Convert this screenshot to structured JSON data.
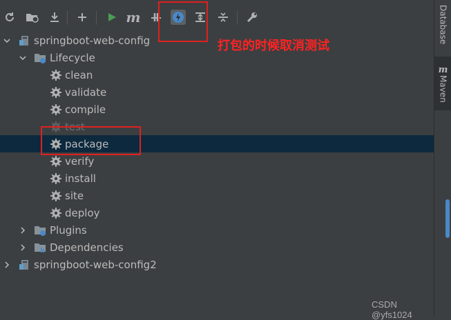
{
  "toolbar": {
    "buttons": [
      {
        "name": "reload-icon"
      },
      {
        "name": "add-folder-icon"
      },
      {
        "name": "download-icon"
      },
      {
        "name": "plus-icon"
      },
      {
        "name": "run-icon"
      },
      {
        "name": "maven-goal-icon",
        "text": "m"
      },
      {
        "name": "skip-tests-icon"
      },
      {
        "name": "offline-mode-icon"
      },
      {
        "name": "show-dependencies-icon"
      },
      {
        "name": "collapse-all-icon"
      },
      {
        "name": "settings-wrench-icon"
      }
    ],
    "maven_letter": "m"
  },
  "annotation": {
    "text": "打包的时候取消测试",
    "color": "#ff2222"
  },
  "tree": {
    "project1": "springboot-web-config",
    "lifecycle": "Lifecycle",
    "goals": [
      "clean",
      "validate",
      "compile",
      "test",
      "package",
      "verify",
      "install",
      "site",
      "deploy"
    ],
    "selected_goal": "package",
    "disabled_goal": "test",
    "plugins": "Plugins",
    "dependencies": "Dependencies",
    "project2": "springboot-web-config2"
  },
  "right_sidebar": {
    "database": "Database",
    "maven": "Maven"
  },
  "watermark": "CSDN @yfs1024",
  "colors": {
    "background": "#3c3f41",
    "selection": "#0d293e",
    "annotation": "#e02020",
    "run_green": "#499c54",
    "accent_blue": "#4a88c7"
  }
}
